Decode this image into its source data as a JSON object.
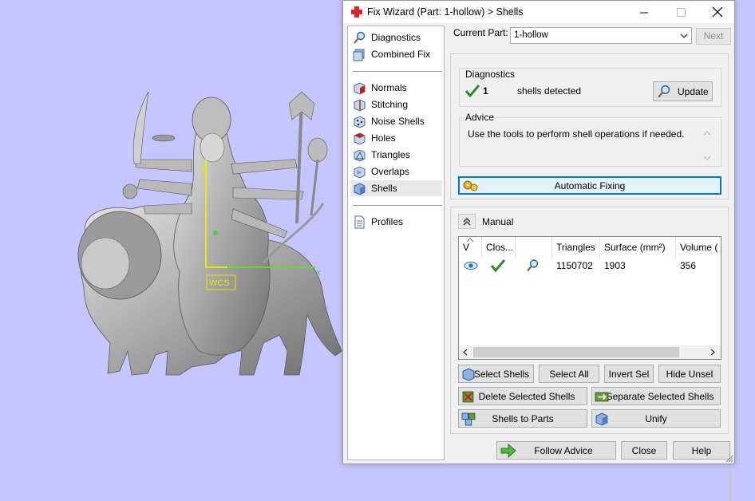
{
  "window": {
    "title": "Fix Wizard (Part: 1-hollow) > Shells",
    "app_icon": "red-cross-icon"
  },
  "viewport": {
    "background": "#c5c5ff",
    "model_label": "WCS",
    "axis_x_label": "x",
    "axis_y_label": "y"
  },
  "nav": {
    "items_top": [
      {
        "label": "Diagnostics",
        "icon": "magnifier-icon"
      },
      {
        "label": "Combined Fix",
        "icon": "combined-fix-icon"
      }
    ],
    "items_mid": [
      {
        "label": "Normals",
        "icon": "normals-icon"
      },
      {
        "label": "Stitching",
        "icon": "stitching-icon"
      },
      {
        "label": "Noise Shells",
        "icon": "noise-shells-icon"
      },
      {
        "label": "Holes",
        "icon": "holes-icon"
      },
      {
        "label": "Triangles",
        "icon": "triangles-icon"
      },
      {
        "label": "Overlaps",
        "icon": "overlaps-icon"
      },
      {
        "label": "Shells",
        "icon": "shells-icon",
        "selected": true
      }
    ],
    "items_bottom": [
      {
        "label": "Profiles",
        "icon": "document-icon"
      }
    ]
  },
  "part": {
    "label": "Current Part:",
    "value": "1-hollow",
    "next_label": "Next"
  },
  "diagnostics": {
    "title": "Diagnostics",
    "count": "1",
    "count_label": "shells detected",
    "update_label": "Update"
  },
  "advice": {
    "title": "Advice",
    "text": "Use the tools to perform shell operations if needed."
  },
  "automatic_fixing_label": "Automatic Fixing",
  "manual": {
    "label": "Manual",
    "columns": [
      "V",
      "Clos...",
      "",
      "Triangles",
      "Surface (mm²)",
      "Volume ("
    ],
    "rows": [
      {
        "visible": "eye-icon",
        "closed": "check-icon",
        "action": "magnifier-icon",
        "triangles": "1150702",
        "surface": "1903",
        "volume": "356"
      }
    ]
  },
  "buttons": {
    "select_shells": "Select Shells",
    "select_all": "Select All",
    "invert_sel": "Invert Sel",
    "hide_unsel": "Hide Unsel",
    "delete_selected": "Delete Selected Shells",
    "separate_selected": "Separate Selected Shells",
    "shells_to_parts": "Shells to Parts",
    "unify": "Unify",
    "follow_advice": "Follow Advice",
    "close": "Close",
    "help": "Help"
  },
  "colors": {
    "accent": "#0078d7",
    "check_green": "#2e8b2e",
    "title_icon_red": "#d8282a"
  }
}
